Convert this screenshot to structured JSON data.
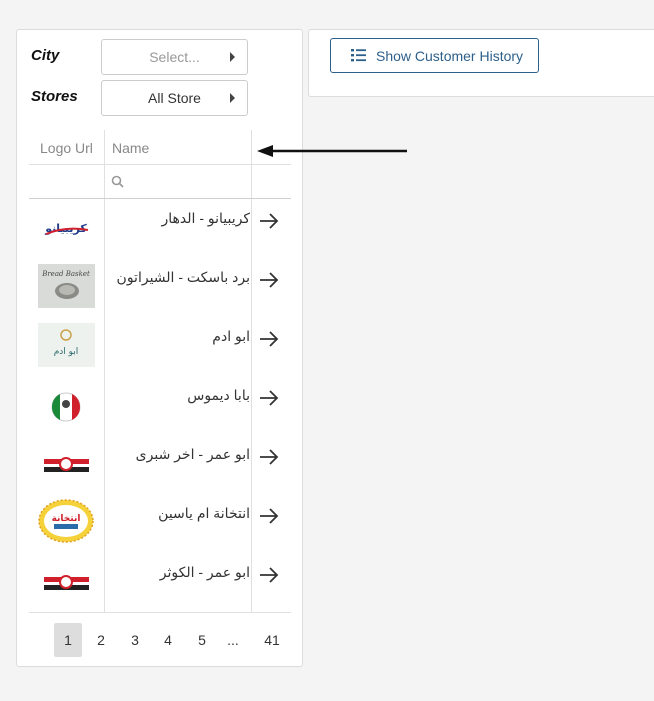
{
  "filters": {
    "city": {
      "label": "City",
      "value": "Select..."
    },
    "stores": {
      "label": "Stores",
      "value": "All Store"
    }
  },
  "toolbar": {
    "show_history_label": "Show Customer History"
  },
  "grid": {
    "columns": [
      "Logo Url",
      "Name"
    ],
    "rows": [
      {
        "name": "كريبيانو - الدهار",
        "logo_text": "كريبيانو"
      },
      {
        "name": "برد باسكت - الشيراتون",
        "logo_text": "Bread Basket"
      },
      {
        "name": "ابو ادم",
        "logo_text": "ابو ادم"
      },
      {
        "name": "بابا ديموس",
        "logo_text": ""
      },
      {
        "name": "ابو عمر - اخر شبرى",
        "logo_text": ""
      },
      {
        "name": "انتخانة ام ياسين",
        "logo_text": "انتخانة"
      },
      {
        "name": "ابو عمر - الكوثر",
        "logo_text": ""
      }
    ]
  },
  "pagination": {
    "pages": [
      "1",
      "2",
      "3",
      "4",
      "5"
    ],
    "ellipsis": "...",
    "last": "41",
    "current": "1"
  },
  "colors": {
    "accent": "#2c5f8a",
    "border": "#dcdcdc"
  }
}
